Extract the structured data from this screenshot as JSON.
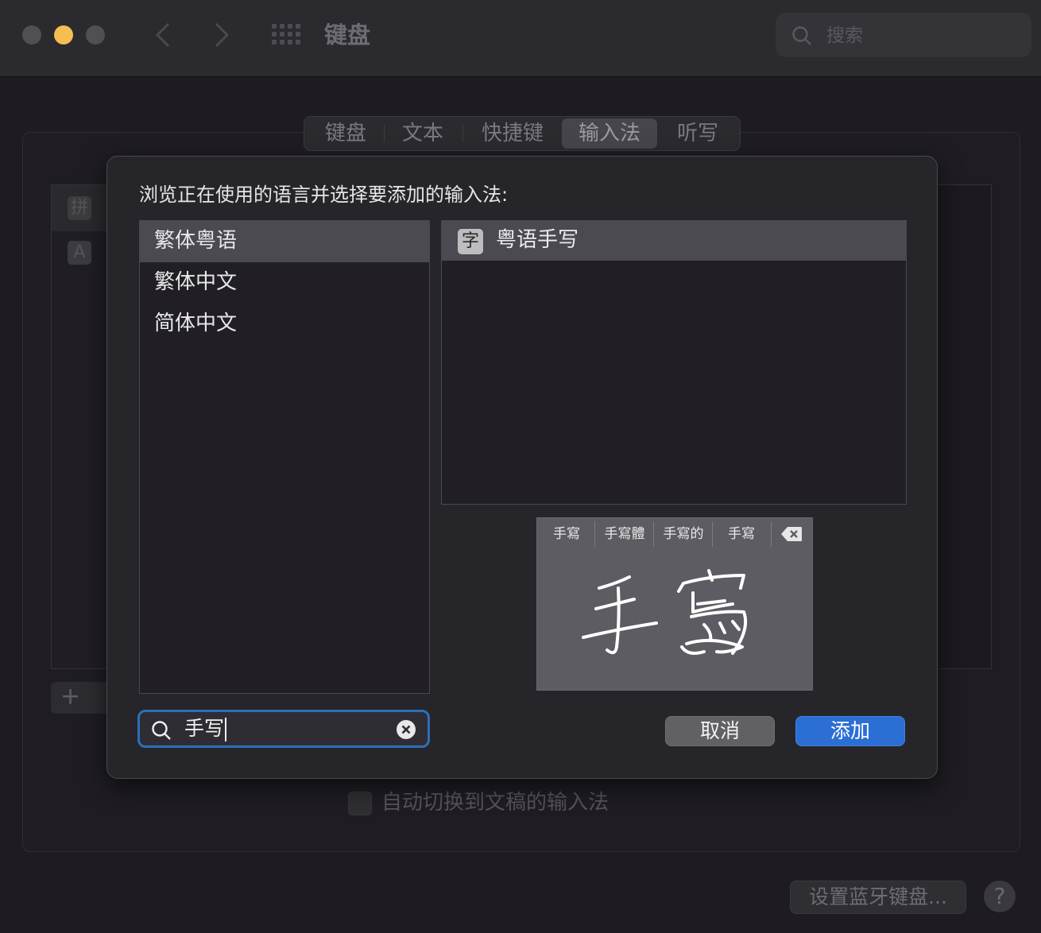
{
  "window": {
    "title": "键盘",
    "search_placeholder": "搜索"
  },
  "tabs": [
    {
      "label": "键盘"
    },
    {
      "label": "文本"
    },
    {
      "label": "快捷键"
    },
    {
      "label": "输入法",
      "selected": true
    },
    {
      "label": "听写"
    }
  ],
  "background": {
    "ime_icons": [
      "拼",
      "A"
    ],
    "add_symbol": "+",
    "auto_switch_label": "自动切换到文稿的输入法",
    "bluetooth_button": "设置蓝牙键盘...",
    "help_symbol": "?"
  },
  "sheet": {
    "prompt": "浏览正在使用的语言并选择要添加的输入法:",
    "languages": [
      {
        "label": "繁体粤语",
        "selected": true
      },
      {
        "label": "繁体中文"
      },
      {
        "label": "简体中文"
      }
    ],
    "input_sources": [
      {
        "icon_text": "字",
        "label": "粤语手写",
        "selected": true
      }
    ],
    "preview": {
      "candidates": [
        "手寫",
        "手寫體",
        "手寫的",
        "手寫"
      ],
      "handwriting_text": "手寫"
    },
    "search": {
      "value": "手写"
    },
    "cancel_label": "取消",
    "add_label": "添加"
  },
  "colors": {
    "accent": "#2c6fd4",
    "focus_ring": "#2c6fb8",
    "traffic_min": "#f4bf4f"
  }
}
